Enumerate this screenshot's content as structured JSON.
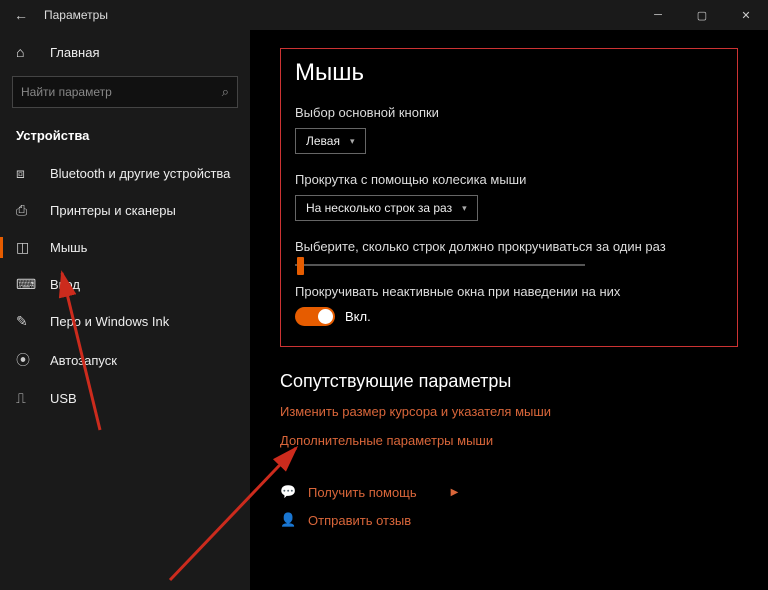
{
  "window": {
    "title": "Параметры"
  },
  "sidebar": {
    "home": "Главная",
    "search_placeholder": "Найти параметр",
    "category": "Устройства",
    "items": [
      {
        "icon": "bt",
        "label": "Bluetooth и другие устройства"
      },
      {
        "icon": "printer",
        "label": "Принтеры и сканеры"
      },
      {
        "icon": "mouse",
        "label": "Мышь"
      },
      {
        "icon": "keyboard",
        "label": "Ввод"
      },
      {
        "icon": "pen",
        "label": "Перо и Windows Ink"
      },
      {
        "icon": "autoplay",
        "label": "Автозапуск"
      },
      {
        "icon": "usb",
        "label": "USB"
      }
    ]
  },
  "page": {
    "title": "Мышь",
    "primary_button_label": "Выбор основной кнопки",
    "primary_button_value": "Левая",
    "scroll_mode_label": "Прокрутка с помощью колесика мыши",
    "scroll_mode_value": "На несколько строк за раз",
    "lines_label": "Выберите, сколько строк должно прокручиваться за один раз",
    "inactive_label": "Прокручивать неактивные окна при наведении на них",
    "toggle_on_text": "Вкл."
  },
  "related": {
    "title": "Сопутствующие параметры",
    "link1": "Изменить размер курсора и указателя мыши",
    "link2": "Дополнительные параметры мыши"
  },
  "help": {
    "get_help": "Получить помощь",
    "feedback": "Отправить отзыв"
  }
}
